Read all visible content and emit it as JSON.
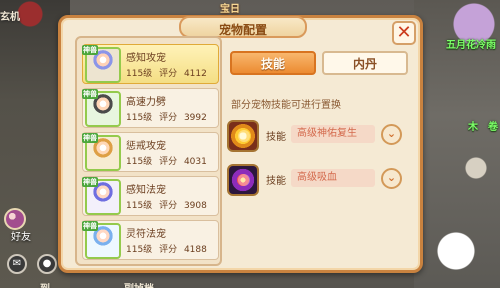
{
  "background": {
    "top_left_text": "玄机",
    "top_center_text": "宝日",
    "right_texts": [
      "五月花冷雨",
      "木",
      "卷"
    ],
    "bottom_texts": [
      "到",
      "副掉档"
    ],
    "friend_label": "好友"
  },
  "dialog": {
    "title": "宠物配置",
    "close_icon": "✕"
  },
  "pets": [
    {
      "badge": "神兽",
      "name": "感知攻宠",
      "level": "115级",
      "score_label": "评分",
      "score": "4112",
      "selected": true
    },
    {
      "badge": "神兽",
      "name": "高速力劈",
      "level": "115级",
      "score_label": "评分",
      "score": "3992",
      "selected": false
    },
    {
      "badge": "神兽",
      "name": "惩戒攻宠",
      "level": "115级",
      "score_label": "评分",
      "score": "4031",
      "selected": false
    },
    {
      "badge": "神兽",
      "name": "感知法宠",
      "level": "115级",
      "score_label": "评分",
      "score": "3908",
      "selected": false
    },
    {
      "badge": "神兽",
      "name": "灵符法宠",
      "level": "115级",
      "score_label": "评分",
      "score": "4188",
      "selected": false
    }
  ],
  "tabs": {
    "skill": "技能",
    "inner_pill": "内丹"
  },
  "hint": "部分宠物技能可进行置换",
  "skills": [
    {
      "label": "技能",
      "value": "高级神佑复生",
      "icon": "revive-icon"
    },
    {
      "label": "技能",
      "value": "高级吸血",
      "icon": "vampire-icon"
    }
  ],
  "icons": {
    "chat": "chat-icon",
    "voice": "voice-icon",
    "dropdown": "chevron-down-icon"
  }
}
